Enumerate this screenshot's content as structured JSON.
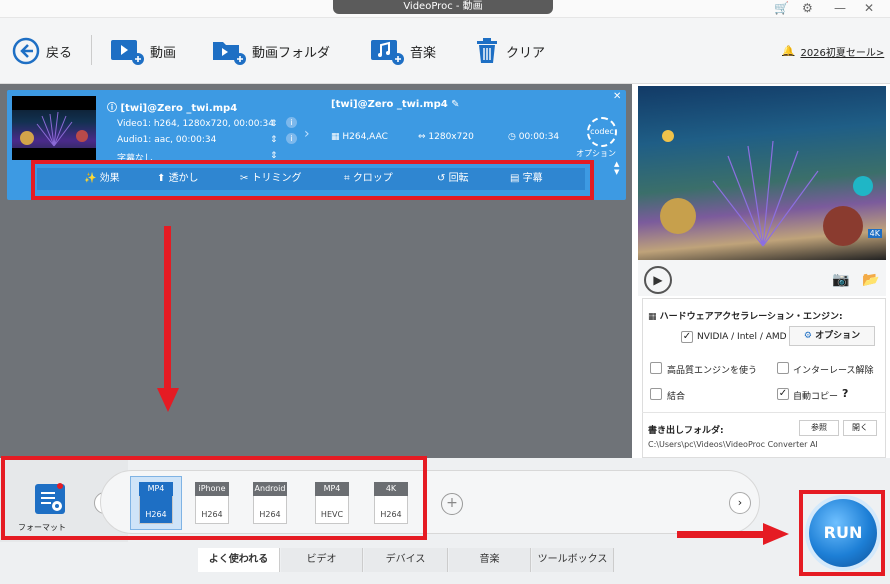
{
  "window": {
    "title": "VideoProc - 動画"
  },
  "toolbar": {
    "back": "戻る",
    "video": "動画",
    "video_folder": "動画フォルダ",
    "music": "音楽",
    "clear": "クリア",
    "promo": "2026初夏セール>"
  },
  "task": {
    "source_name": "[twi]@Zero _twi.mp4",
    "video_info": "Video1: h264, 1280x720, 00:00:34",
    "audio_info": "Audio1: aac, 00:00:34",
    "subtitle": "字幕なし",
    "output_name": "[twi]@Zero _twi.mp4",
    "codec": "H264,AAC",
    "resolution": "1280x720",
    "duration": "00:00:34",
    "codec_badge": "codec",
    "option_label": "オプション"
  },
  "edit": {
    "effect": "効果",
    "watermark": "透かし",
    "trim": "トリミング",
    "crop": "クロップ",
    "rotate": "回転",
    "subtitle": "字幕"
  },
  "settings": {
    "hw_title": "ハードウェアアクセラレーション・エンジン:",
    "nvidia": "NVIDIA / Intel / AMD",
    "option_btn": "オプション",
    "hq_engine": "高品質エンジンを使う",
    "deinterlace": "インターレース解除",
    "merge": "結合",
    "autocopy": "自動コピー",
    "help": "?",
    "output_folder_label": "書き出しフォルダ:",
    "browse": "参照",
    "open": "開く",
    "output_path": "C:\\Users\\pc\\Videos\\VideoProc Converter AI"
  },
  "format_label": "フォーマット",
  "formats": [
    {
      "tag": "MP4",
      "codec": "H264"
    },
    {
      "tag": "iPhone",
      "codec": "H264"
    },
    {
      "tag": "Android",
      "codec": "H264"
    },
    {
      "tag": "MP4",
      "codec": "HEVC"
    },
    {
      "tag": "4K",
      "codec": "H264"
    }
  ],
  "tabs": [
    "よく使われる",
    "ビデオ",
    "デバイス",
    "音楽",
    "ツールボックス"
  ],
  "run": "RUN",
  "preview_badge": "4K"
}
